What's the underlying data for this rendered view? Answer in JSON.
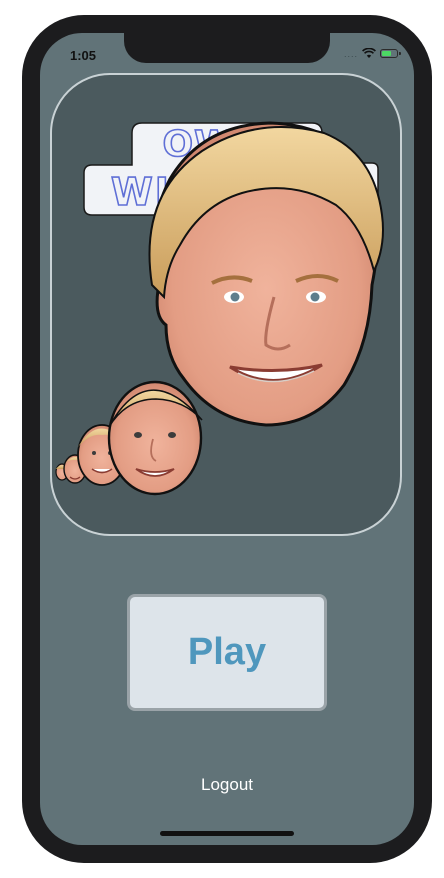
{
  "status_bar": {
    "time": "1:05",
    "signal_dots": "....",
    "icons": [
      "wifi-icon",
      "battery-charging-icon"
    ],
    "battery_level": 0.55
  },
  "hero": {
    "logo_line1": "OWEN",
    "logo_line2": "WILSNAKE",
    "face_count": 5
  },
  "actions": {
    "play_label": "Play",
    "logout_label": "Logout"
  },
  "colors": {
    "screen_bg": "#617378",
    "card_bg": "#4b5a5e",
    "play_text": "#4f97bd",
    "logo_stroke": "#5f6fd6"
  }
}
